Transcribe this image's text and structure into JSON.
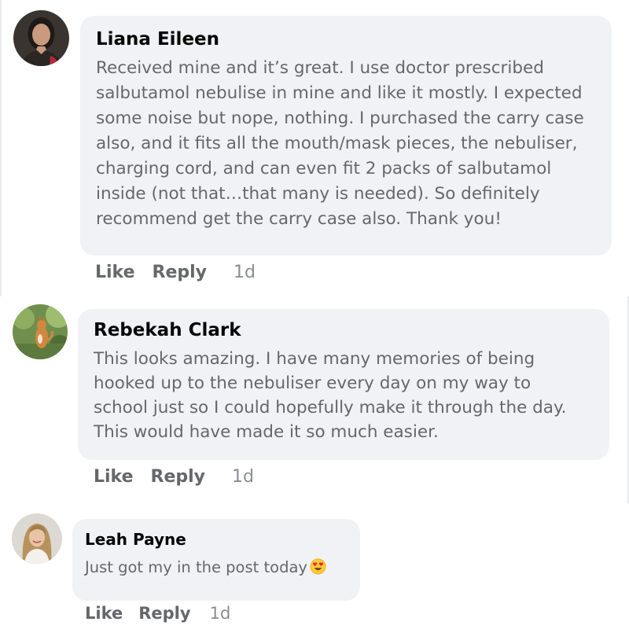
{
  "comments": [
    {
      "author": "Liana Eileen",
      "lines": [
        "Received mine and it’s great. I use doctor prescribed",
        "salbutamol nebulise in mine and like it mostly. I expected",
        "some noise but nope, nothing. I purchased the carry case",
        "also, and it fits all the mouth/mask pieces, the nebuliser,",
        "charging cord, and can even fit 2 packs of salbutamol",
        "inside (not that…that many is needed). So definitely",
        "recommend get the carry case also. Thank you!"
      ],
      "like_label": "Like",
      "reply_label": "Reply",
      "time": "1d"
    },
    {
      "author": "Rebekah Clark",
      "lines": [
        "This looks amazing. I have many memories of being",
        "hooked up to the nebuliser every day on my way to",
        "school just so I could hopefully make it through the day.",
        "This would have made it so much easier."
      ],
      "like_label": "Like",
      "reply_label": "Reply",
      "time": "1d"
    },
    {
      "author": "Leah Payne",
      "lines": [
        "Just got my in the post today"
      ],
      "emoji": "heart-eyes-emoji",
      "like_label": "Like",
      "reply_label": "Reply",
      "time": "1d"
    }
  ],
  "colors": {
    "bubble_bg": "#f0f2f5",
    "author_text": "#050505",
    "body_text": "#65676b",
    "timestamp": "#8a8d91"
  }
}
